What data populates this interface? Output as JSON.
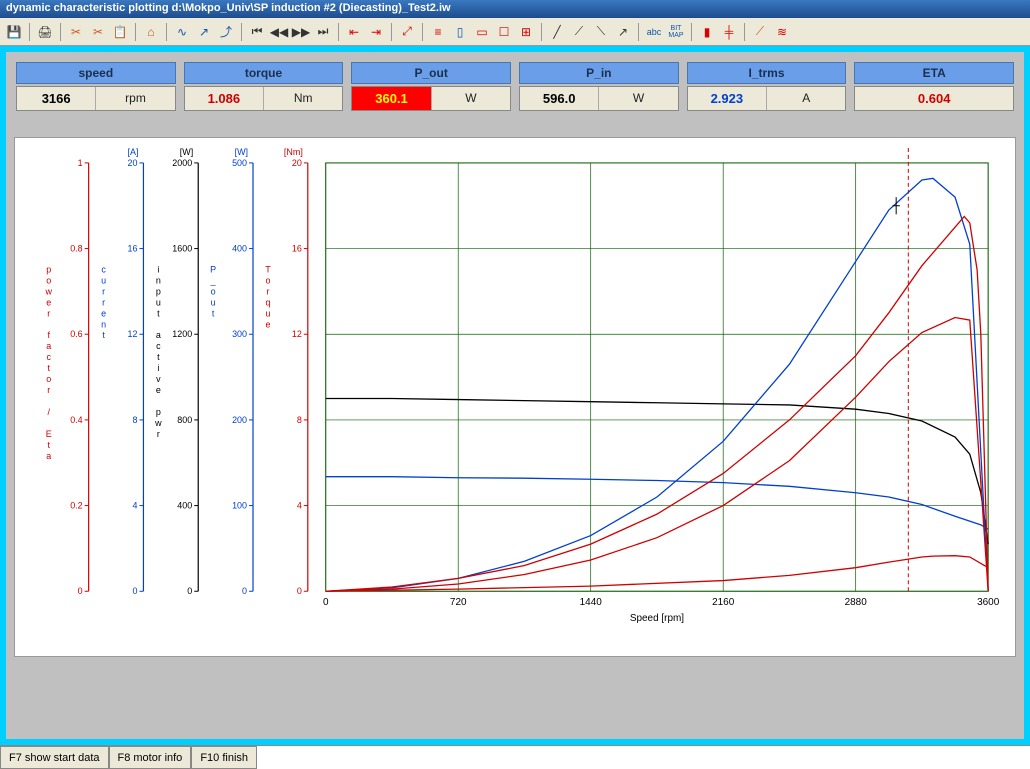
{
  "window": {
    "title": "dynamic characteristic plotting  d:\\Mokpo_Univ\\SP induction #2 (Diecasting)_Test2.iw"
  },
  "toolbar": {
    "items": [
      "save",
      "print",
      "cut",
      "copy",
      "paste",
      "home",
      "curve1",
      "curve2",
      "curve3",
      "first",
      "prev",
      "next",
      "last",
      "zoomout",
      "zoomin",
      "fit",
      "ruler",
      "hbar",
      "vbar",
      "box",
      "grid",
      "line1",
      "line2",
      "line3",
      "line4",
      "text",
      "bitmap",
      "mark1",
      "mark2",
      "mark3",
      "mark4"
    ]
  },
  "readouts": [
    {
      "label": "speed",
      "value": "3166",
      "unit": "rpm",
      "cls": ""
    },
    {
      "label": "torque",
      "value": "1.086",
      "unit": "Nm",
      "cls": "red"
    },
    {
      "label": "P_out",
      "value": "360.1",
      "unit": "W",
      "cls": "hot"
    },
    {
      "label": "P_in",
      "value": "596.0",
      "unit": "W",
      "cls": ""
    },
    {
      "label": "I_trms",
      "value": "2.923",
      "unit": "A",
      "cls": "blue"
    },
    {
      "label": "ETA",
      "value": "0.604",
      "unit": null,
      "cls": "red"
    }
  ],
  "statusbar": {
    "buttons": [
      {
        "label": "F7 show start data"
      },
      {
        "label": "F8 motor info"
      },
      {
        "label": "F10 finish"
      }
    ]
  },
  "chart_data": {
    "type": "line",
    "xlabel": "Speed [rpm]",
    "xlim": [
      0,
      3600
    ],
    "xticks": [
      0,
      720,
      1440,
      2160,
      2880,
      3600
    ],
    "axes": [
      {
        "name": "power factor / Eta",
        "unit": "",
        "color": "#d00000",
        "range": [
          0,
          1
        ],
        "ticks": [
          0,
          0.2,
          0.4,
          0.6,
          0.8,
          1
        ]
      },
      {
        "name": "current",
        "unit": "[A]",
        "color": "#0040d0",
        "range": [
          0,
          20
        ],
        "ticks": [
          0,
          4,
          8,
          12,
          16,
          20
        ]
      },
      {
        "name": "input active pwr",
        "unit": "[W]",
        "color": "#000000",
        "range": [
          0,
          2000
        ],
        "ticks": [
          0,
          400,
          800,
          1200,
          1600,
          2000
        ]
      },
      {
        "name": "P_out",
        "unit": "[W]",
        "color": "#0040d0",
        "range": [
          0,
          500
        ],
        "ticks": [
          0,
          100,
          200,
          300,
          400,
          500
        ]
      },
      {
        "name": "Torque",
        "unit": "[Nm]",
        "color": "#d00000",
        "range": [
          0,
          20
        ],
        "ticks": [
          0,
          4,
          8,
          12,
          16,
          20
        ]
      }
    ],
    "cursor_x": 3166,
    "series": [
      {
        "name": "P_in",
        "axis": 2,
        "color": "#000000",
        "x": [
          0,
          360,
          720,
          1080,
          1440,
          1800,
          2160,
          2520,
          2880,
          3060,
          3240,
          3420,
          3500,
          3560,
          3600
        ],
        "y": [
          900,
          900,
          895,
          890,
          885,
          880,
          875,
          870,
          850,
          830,
          795,
          720,
          640,
          460,
          220
        ]
      },
      {
        "name": "I_trms",
        "axis": 1,
        "color": "#0040d0",
        "x": [
          0,
          360,
          720,
          1080,
          1440,
          1800,
          2160,
          2520,
          2880,
          3060,
          3240,
          3420,
          3560,
          3600
        ],
        "y": [
          5.35,
          5.35,
          5.3,
          5.28,
          5.23,
          5.17,
          5.07,
          4.9,
          4.6,
          4.4,
          4.05,
          3.5,
          3.1,
          2.9
        ]
      },
      {
        "name": "P_out",
        "axis": 3,
        "color": "#0040d0",
        "x": [
          0,
          360,
          720,
          1080,
          1440,
          1800,
          2160,
          2520,
          2880,
          3060,
          3240,
          3300,
          3420,
          3500,
          3600
        ],
        "y": [
          0,
          4,
          15,
          35,
          65,
          110,
          175,
          265,
          385,
          445,
          480,
          482,
          460,
          405,
          0
        ]
      },
      {
        "name": "Torque",
        "axis": 4,
        "color": "#d00000",
        "x": [
          0,
          360,
          720,
          1080,
          1440,
          1800,
          2160,
          2520,
          2880,
          3060,
          3240,
          3420,
          3470,
          3500,
          3540,
          3560,
          3600
        ],
        "y": [
          0,
          0.2,
          0.6,
          1.2,
          2.2,
          3.6,
          5.5,
          8.0,
          11.0,
          13.0,
          15.2,
          17.0,
          17.5,
          17.2,
          15.0,
          12.0,
          0
        ]
      },
      {
        "name": "ETA",
        "axis": 0,
        "color": "#d00000",
        "x": [
          0,
          360,
          720,
          1080,
          1440,
          1800,
          2160,
          2520,
          2880,
          3060,
          3240,
          3420,
          3500,
          3600
        ],
        "y": [
          0,
          0.005,
          0.017,
          0.039,
          0.073,
          0.125,
          0.2,
          0.305,
          0.453,
          0.536,
          0.604,
          0.639,
          0.633,
          0
        ]
      },
      {
        "name": "PF",
        "axis": 0,
        "color": "#d00000",
        "x": [
          0,
          720,
          1440,
          2160,
          2520,
          2880,
          3060,
          3166,
          3240,
          3300,
          3420,
          3500,
          3600
        ],
        "y": [
          0,
          0.005,
          0.012,
          0.025,
          0.037,
          0.055,
          0.068,
          0.075,
          0.08,
          0.082,
          0.083,
          0.08,
          0.055
        ]
      }
    ]
  }
}
